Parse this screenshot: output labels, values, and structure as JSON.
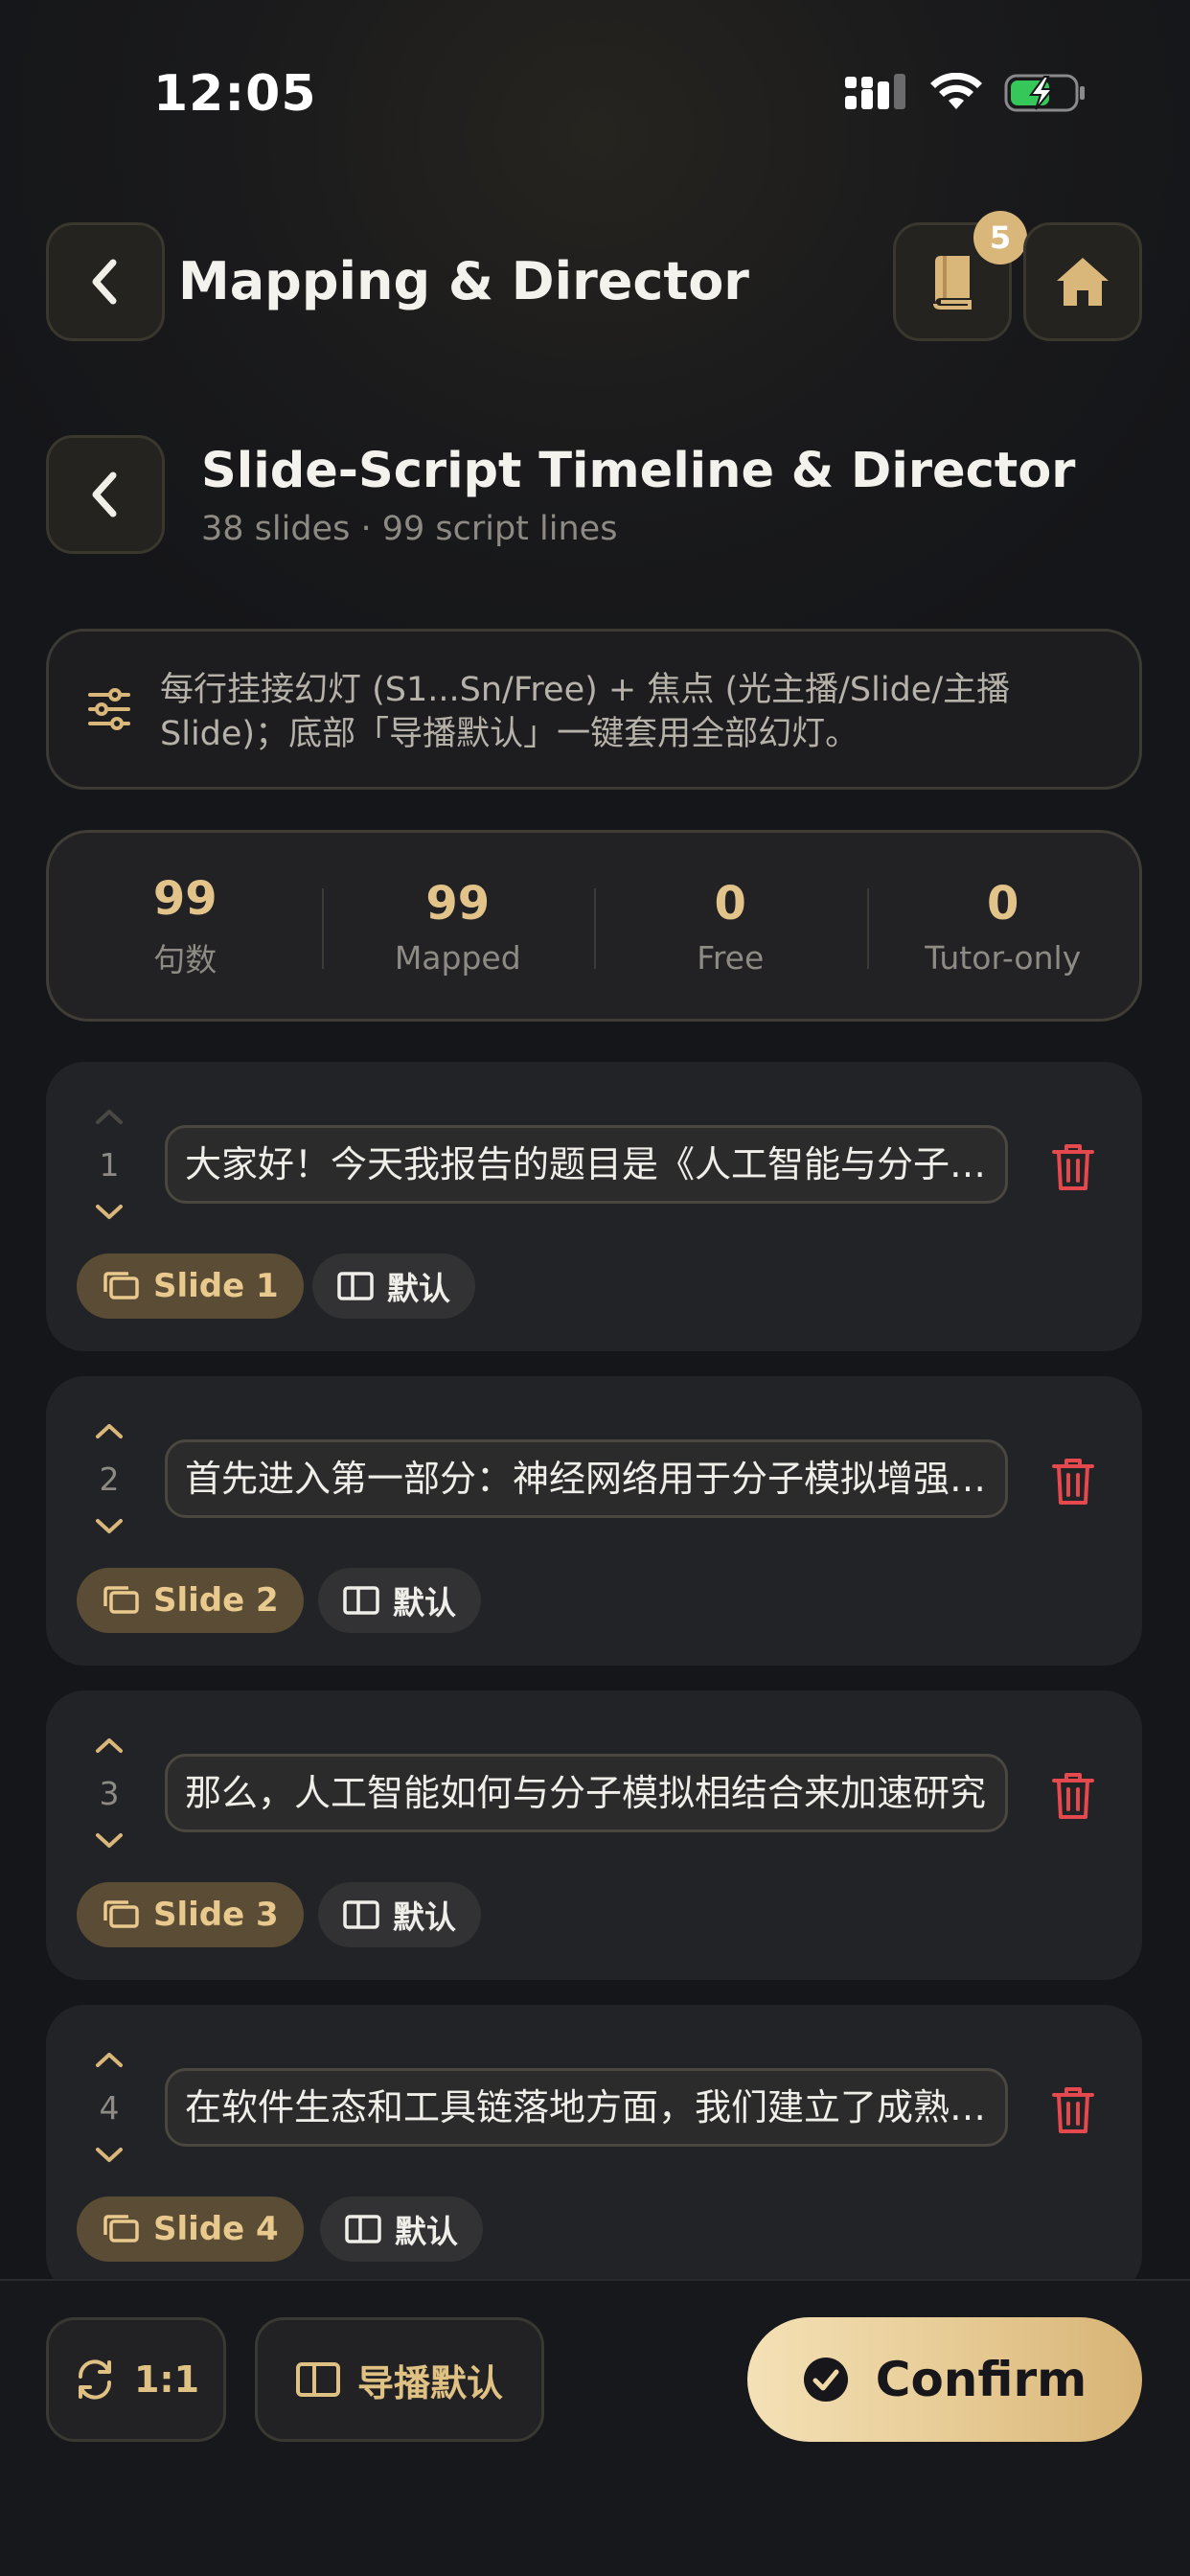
{
  "status_bar": {
    "time": "12:05"
  },
  "header": {
    "title": "Mapping & Director",
    "notification_count": "5"
  },
  "section": {
    "title": "Slide-Script Timeline & Director",
    "subtitle": "38 slides · 99 script lines"
  },
  "info": {
    "text": "每行挂接幻灯 (S1...Sn/Free) + 焦点 (光主播/Slide/主播Slide)；底部「导播默认」一键套用全部幻灯。"
  },
  "stats": [
    {
      "value": "99",
      "label": "句数"
    },
    {
      "value": "99",
      "label": "Mapped"
    },
    {
      "value": "0",
      "label": "Free"
    },
    {
      "value": "0",
      "label": "Tutor-only"
    }
  ],
  "lines": [
    {
      "num": "1",
      "text": "大家好！今天我报告的题目是《人工智能与分子模拟》",
      "slide": "Slide 1",
      "focus": "默认"
    },
    {
      "num": "2",
      "text": "首先进入第一部分：神经网络用于分子模拟增强采样",
      "slide": "Slide 2",
      "focus": "默认"
    },
    {
      "num": "3",
      "text": "那么，人工智能如何与分子模拟相结合来加速研究",
      "slide": "Slide 3",
      "focus": "默认"
    },
    {
      "num": "4",
      "text": "在软件生态和工具链落地方面，我们建立了成熟的流程",
      "slide": "Slide 4",
      "focus": "默认"
    }
  ],
  "bottom": {
    "ratio_label": "1:1",
    "director_default_label": "导播默认",
    "confirm_label": "Confirm"
  },
  "colors": {
    "accent": "#e2c38a",
    "danger": "#e5484d",
    "background": "#15161a"
  }
}
